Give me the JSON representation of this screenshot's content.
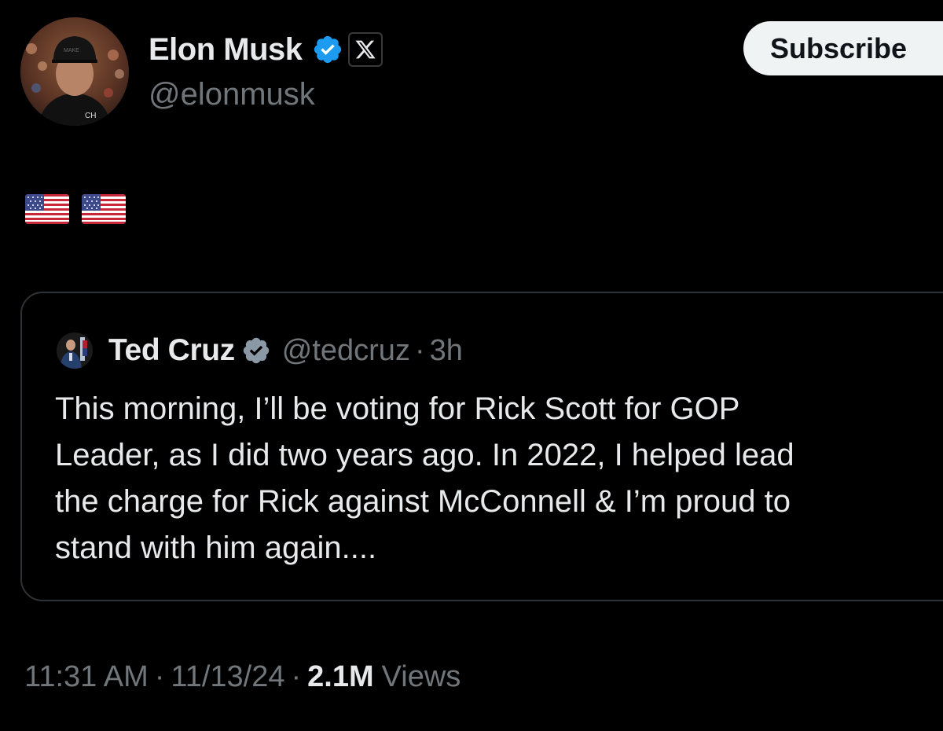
{
  "post": {
    "author_name": "Elon Musk",
    "author_handle": "@elonmusk",
    "verified_icon": "verified-badge-icon",
    "affiliate_icon": "x-logo-icon",
    "subscribe_label": "Subscribe",
    "text_emojis": [
      "🇺🇸",
      "🇺🇸"
    ],
    "time": "11:31 AM",
    "date": "11/13/24",
    "separator": "·",
    "views_count": "2.1M",
    "views_label": "Views"
  },
  "quote": {
    "author_name": "Ted Cruz",
    "author_handle": "@tedcruz",
    "separator": "·",
    "time_ago": "3h",
    "text": "This morning, I’ll be voting for Rick Scott for GOP\nLeader, as I did two years ago. In 2022, I helped lead\nthe charge for Rick against McConnell & I’m proud to\nstand with him again...."
  },
  "colors": {
    "background": "#000000",
    "primary_text": "#e7e9ea",
    "secondary_text": "#71767b",
    "verified_blue": "#1d9bf0",
    "border": "#2f3336",
    "button_bg": "#eff3f4"
  }
}
